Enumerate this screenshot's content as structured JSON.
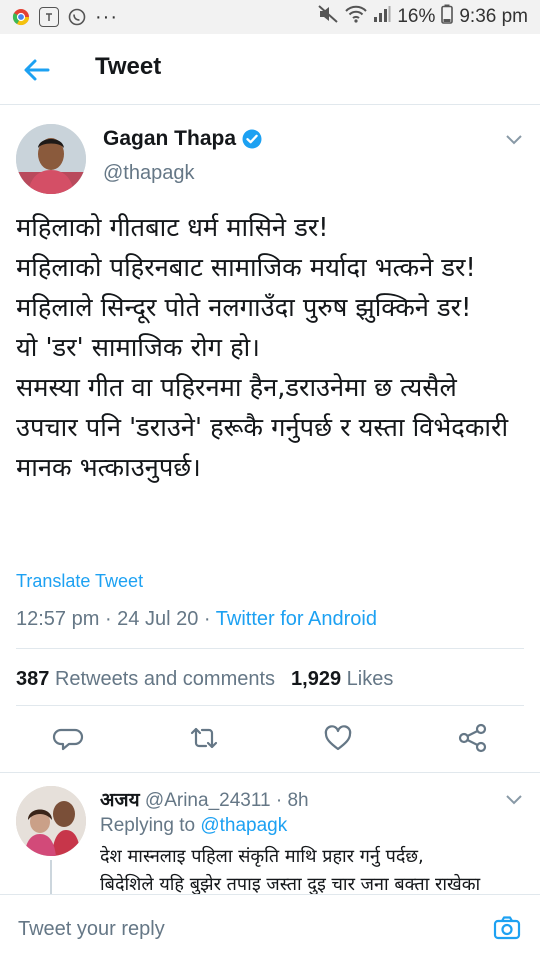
{
  "status_bar": {
    "battery": "16%",
    "time": "9:36 pm",
    "dots": "···"
  },
  "header": {
    "title": "Tweet",
    "back_icon": "arrow-left-icon"
  },
  "tweet": {
    "author_name": "Gagan Thapa",
    "author_handle": "@thapagk",
    "verified": true,
    "text": "महिलाको गीतबाट धर्म मासिने डर!\nमहिलाको पहिरनबाट सामाजिक मर्यादा भत्कने डर!\nमहिलाले सिन्दूर पोते नलगाउँदा पुरुष झुक्किने डर!\nयो 'डर' सामाजिक रोग हो।\nसमस्या गीत वा पहिरनमा हैन,डराउनेमा छ त्यसैले उपचार पनि 'डराउने' हरूकै गर्नुपर्छ र यस्ता विभेदकारी मानक भत्काउनुपर्छ।",
    "translate_label": "Translate Tweet",
    "time": "12:57 pm",
    "date": "24 Jul 20",
    "source": "Twitter for Android",
    "retweets_count": "387",
    "retweets_label": "Retweets and comments",
    "likes_count": "1,929",
    "likes_label": "Likes",
    "actions": [
      "reply-icon",
      "retweet-icon",
      "like-icon",
      "share-icon"
    ]
  },
  "reply": {
    "name": "अजय",
    "handle": "@Arina_24311",
    "time": "8h",
    "replying_label": "Replying to",
    "replying_to": "@thapagk",
    "text": "देश मास्नलाइ पहिला संकृति माथि प्रहार गर्नु पर्दछ,\nबिदेशिले यहि बुझेर तपाइ जस्ता दुइ चार जना बक्ता राखेका"
  },
  "compose": {
    "placeholder": "Tweet your reply",
    "camera_icon": "camera-icon"
  },
  "colors": {
    "accent": "#1da1f2",
    "secondary_text": "#657786",
    "text": "#14171a",
    "divider": "#e1e8ed"
  }
}
